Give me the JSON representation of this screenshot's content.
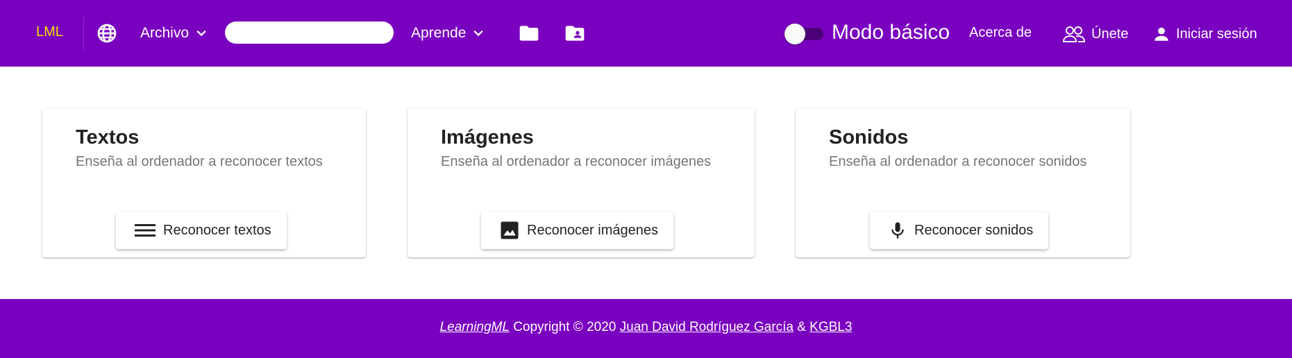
{
  "colors": {
    "header_bg": "#7a00bf",
    "logo": "#f2e200",
    "footer_bg": "#7a00bf"
  },
  "header": {
    "logo": "LML",
    "language_icon": "globe-icon",
    "menus": {
      "archivo": "Archivo",
      "aprende": "Aprende"
    },
    "search": {
      "value": "",
      "placeholder": ""
    },
    "folder_icon": "folder-icon",
    "shared_folder_icon": "folder-account-icon",
    "basic_mode": {
      "label": "Modo básico",
      "enabled": false
    },
    "links": {
      "about": "Acerca de",
      "join": "Únete",
      "login": "Iniciar sesión"
    }
  },
  "cards": [
    {
      "title": "Textos",
      "subtitle": "Enseña al ordenador a reconocer textos",
      "button": "Reconocer textos",
      "icon": "lines-icon"
    },
    {
      "title": "Imágenes",
      "subtitle": "Enseña al ordenador a reconocer imágenes",
      "button": "Reconocer imágenes",
      "icon": "image-icon"
    },
    {
      "title": "Sonidos",
      "subtitle": "Enseña al ordenador a reconocer sonidos",
      "button": "Reconocer sonidos",
      "icon": "microphone-icon"
    }
  ],
  "footer": {
    "brand": "LearningML",
    "copyright": " Copyright © 2020 ",
    "author": "Juan David Rodríguez García",
    "amp": " & ",
    "partner": "KGBL3"
  }
}
